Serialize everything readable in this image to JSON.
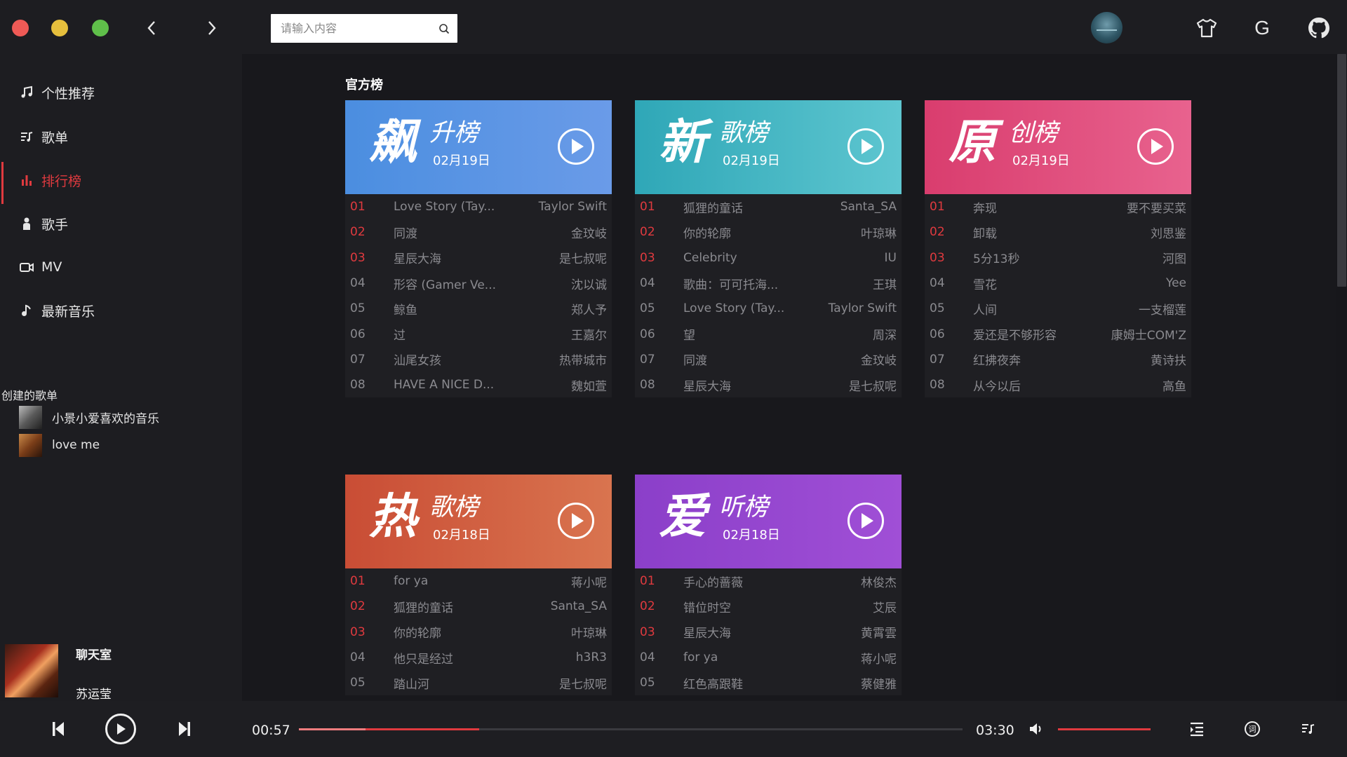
{
  "search": {
    "placeholder": "请输入内容"
  },
  "sidebar": {
    "menu": [
      {
        "label": "个性推荐",
        "icon": "music-note-icon"
      },
      {
        "label": "歌单",
        "icon": "playlist-icon"
      },
      {
        "label": "排行榜",
        "icon": "bar-chart-icon",
        "active": true
      },
      {
        "label": "歌手",
        "icon": "person-icon"
      },
      {
        "label": "MV",
        "icon": "video-camera-icon"
      },
      {
        "label": "最新音乐",
        "icon": "music-disc-icon"
      }
    ],
    "created_title": "创建的歌单",
    "playlists": [
      {
        "name": "小景小爱喜欢的音乐"
      },
      {
        "name": "love me"
      }
    ]
  },
  "now_playing": {
    "title": "聊天室",
    "artist": "苏运莹"
  },
  "main": {
    "section_title": "官方榜",
    "charts": [
      {
        "big": "飙",
        "small": "升榜",
        "date": "02月19日",
        "colors": [
          "#4b8ee0",
          "#6a9be8"
        ],
        "rows": [
          {
            "rank": "01",
            "song": "Love Story (Tay...",
            "artist": "Taylor Swift"
          },
          {
            "rank": "02",
            "song": "同渡",
            "artist": "金玟岐"
          },
          {
            "rank": "03",
            "song": "星辰大海",
            "artist": "是七叔呢"
          },
          {
            "rank": "04",
            "song": "形容 (Gamer Ve...",
            "artist": "沈以诚"
          },
          {
            "rank": "05",
            "song": "鲸鱼",
            "artist": "郑人予"
          },
          {
            "rank": "06",
            "song": "过",
            "artist": "王嘉尔"
          },
          {
            "rank": "07",
            "song": "汕尾女孩",
            "artist": "热带城市"
          },
          {
            "rank": "08",
            "song": "HAVE A NICE D...",
            "artist": "魏如萱"
          }
        ]
      },
      {
        "big": "新",
        "small": "歌榜",
        "date": "02月19日",
        "colors": [
          "#2fa7b7",
          "#5ec6d0"
        ],
        "rows": [
          {
            "rank": "01",
            "song": "狐狸的童话",
            "artist": "Santa_SA"
          },
          {
            "rank": "02",
            "song": "你的轮廓",
            "artist": "叶琼琳"
          },
          {
            "rank": "03",
            "song": "Celebrity",
            "artist": "IU"
          },
          {
            "rank": "04",
            "song": "歌曲：可可托海...",
            "artist": "王琪"
          },
          {
            "rank": "05",
            "song": "Love Story (Tay...",
            "artist": "Taylor Swift"
          },
          {
            "rank": "06",
            "song": "望",
            "artist": "周深"
          },
          {
            "rank": "07",
            "song": "同渡",
            "artist": "金玟岐"
          },
          {
            "rank": "08",
            "song": "星辰大海",
            "artist": "是七叔呢"
          }
        ]
      },
      {
        "big": "原",
        "small": "创榜",
        "date": "02月19日",
        "colors": [
          "#d93d6e",
          "#e8628e"
        ],
        "rows": [
          {
            "rank": "01",
            "song": "奔现",
            "artist": "要不要买菜"
          },
          {
            "rank": "02",
            "song": "卸载",
            "artist": "刘思鉴"
          },
          {
            "rank": "03",
            "song": "5分13秒",
            "artist": "河图"
          },
          {
            "rank": "04",
            "song": "雪花",
            "artist": "Yee"
          },
          {
            "rank": "05",
            "song": "人间",
            "artist": "一支榴莲"
          },
          {
            "rank": "06",
            "song": "爱还是不够形容",
            "artist": "康姆士COM'Z"
          },
          {
            "rank": "07",
            "song": "红拂夜奔",
            "artist": "黄诗扶"
          },
          {
            "rank": "08",
            "song": "从今以后",
            "artist": "高鱼"
          }
        ]
      },
      {
        "big": "热",
        "small": "歌榜",
        "date": "02月18日",
        "colors": [
          "#c94d35",
          "#d9744f"
        ],
        "rows": [
          {
            "rank": "01",
            "song": "for ya",
            "artist": "蒋小呢"
          },
          {
            "rank": "02",
            "song": "狐狸的童话",
            "artist": "Santa_SA"
          },
          {
            "rank": "03",
            "song": "你的轮廓",
            "artist": "叶琼琳"
          },
          {
            "rank": "04",
            "song": "他只是经过",
            "artist": "h3R3"
          },
          {
            "rank": "05",
            "song": "踏山河",
            "artist": "是七叔呢"
          }
        ]
      },
      {
        "big": "爱",
        "small": "听榜",
        "date": "02月18日",
        "colors": [
          "#8b3fc9",
          "#a04fd6"
        ],
        "rows": [
          {
            "rank": "01",
            "song": "手心的蔷薇",
            "artist": "林俊杰"
          },
          {
            "rank": "02",
            "song": "错位时空",
            "artist": "艾辰"
          },
          {
            "rank": "03",
            "song": "星辰大海",
            "artist": "黄霄雲"
          },
          {
            "rank": "04",
            "song": "for ya",
            "artist": "蒋小呢"
          },
          {
            "rank": "05",
            "song": "红色高跟鞋",
            "artist": "蔡健雅"
          }
        ]
      }
    ]
  },
  "player": {
    "current_time": "00:57",
    "total_time": "03:30",
    "played_fraction": 0.1,
    "buffered_fraction": 0.272,
    "volume_fraction": 1.0,
    "accent_color": "#e03a3f",
    "lyrics_label": "词"
  },
  "top_right": {
    "g_label": "G"
  }
}
